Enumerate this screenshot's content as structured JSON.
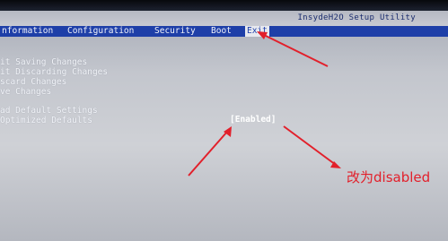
{
  "header": {
    "title": "InsydeH2O Setup Utility"
  },
  "menu": {
    "tabs": [
      {
        "label": "nformation"
      },
      {
        "label": "Configuration"
      },
      {
        "label": "Security"
      },
      {
        "label": "Boot"
      },
      {
        "label": "Exit"
      }
    ],
    "active_tab": "Exit"
  },
  "exit_menu": {
    "items": [
      {
        "label": "it Saving Changes"
      },
      {
        "label": "it Discarding Changes"
      },
      {
        "label": "scard Changes"
      },
      {
        "label": "ve Changes"
      },
      {
        "label": "ad Default Settings"
      },
      {
        "label": "Optimized Defaults"
      }
    ],
    "optimized_defaults_value": "[Enabled]"
  },
  "annotation": {
    "text": "改为disabled",
    "color": "#e2202b"
  },
  "colors": {
    "menu_bar": "#1e3fa8",
    "background": "#c3c6cd"
  }
}
